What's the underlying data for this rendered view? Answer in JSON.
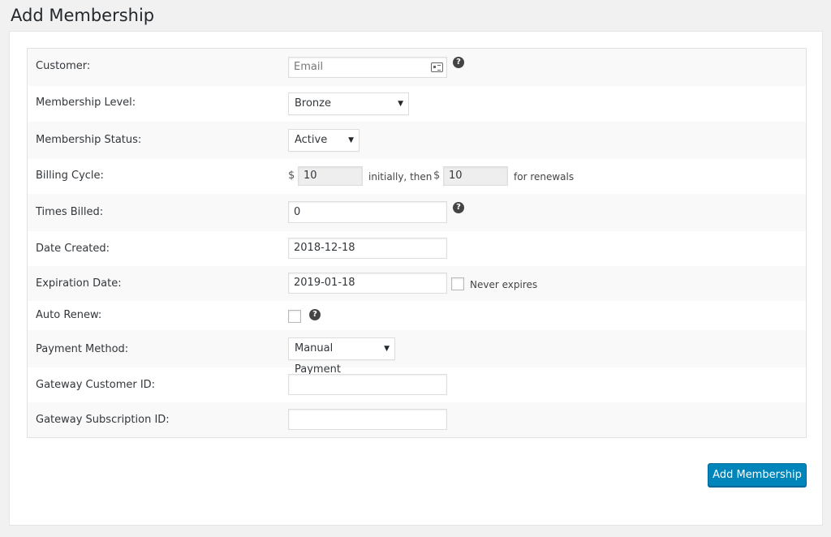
{
  "page": {
    "title": "Add Membership"
  },
  "form": {
    "customer": {
      "label": "Customer:",
      "placeholder": "Email"
    },
    "membership_level": {
      "label": "Membership Level:",
      "value": "Bronze"
    },
    "membership_status": {
      "label": "Membership Status:",
      "value": "Active"
    },
    "billing_cycle": {
      "label": "Billing Cycle:",
      "currency": "$",
      "initial": "10",
      "middle_text": "initially, then",
      "renewal": "10",
      "suffix_text": "for renewals"
    },
    "times_billed": {
      "label": "Times Billed:",
      "value": "0"
    },
    "date_created": {
      "label": "Date Created:",
      "value": "2018-12-18"
    },
    "expiration_date": {
      "label": "Expiration Date:",
      "value": "2019-01-18",
      "never_expires_label": "Never expires",
      "never_expires_checked": false
    },
    "auto_renew": {
      "label": "Auto Renew:",
      "checked": false
    },
    "payment_method": {
      "label": "Payment Method:",
      "value": "Manual Payment"
    },
    "gateway_customer_id": {
      "label": "Gateway Customer ID:",
      "value": ""
    },
    "gateway_subscription_id": {
      "label": "Gateway Subscription ID:",
      "value": ""
    },
    "help_glyph": "?",
    "caret_glyph": "▼"
  },
  "actions": {
    "submit_label": "Add Membership"
  },
  "colors": {
    "primary": "#0085ba",
    "background": "#f1f1f1"
  }
}
